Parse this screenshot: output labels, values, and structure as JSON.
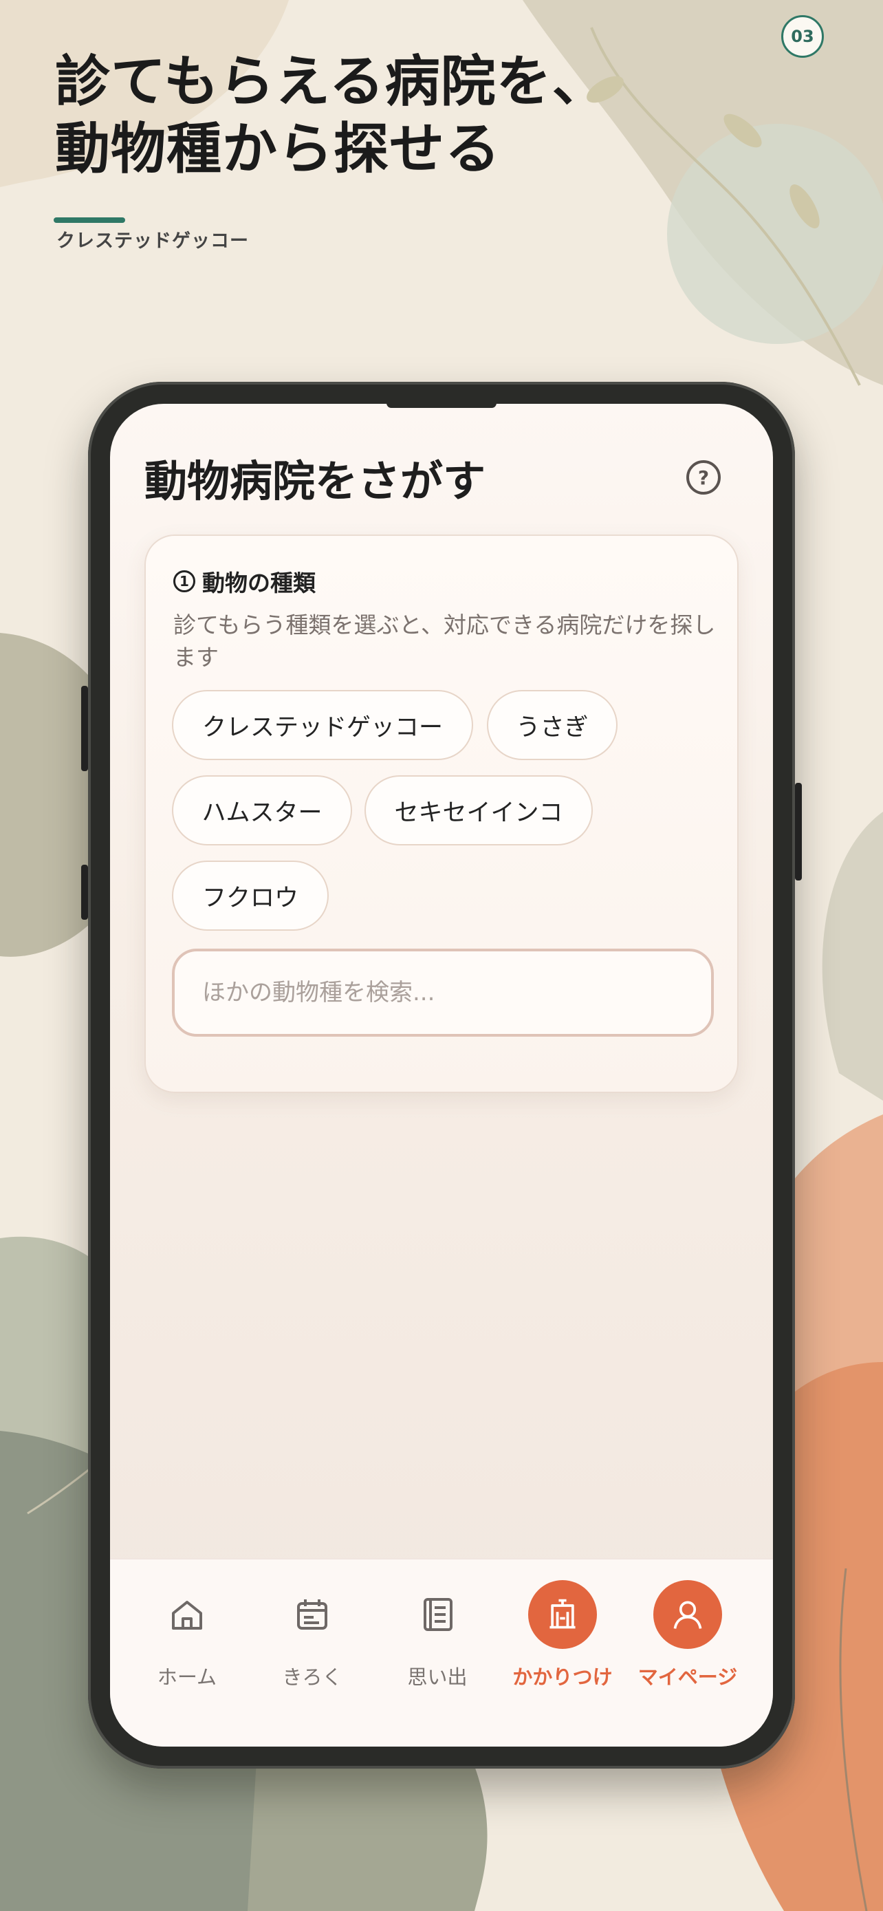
{
  "promo": {
    "badge": "03",
    "headline_line1": "診てもらえる病院を、",
    "headline_line2": "動物種から探せる",
    "subtitle": "クレステッドゲッコー"
  },
  "screen": {
    "title": "動物病院をさがす",
    "help_icon": "question-circle-icon",
    "species_section": {
      "step_number": "1",
      "label": "動物の種類",
      "description": "診てもらう種類を選ぶと、対応できる病院だけを探します",
      "chips": [
        "クレステッドゲッコー",
        "うさぎ",
        "ハムスター",
        "セキセイインコ",
        "フクロウ"
      ],
      "search_placeholder": "ほかの動物種を検索..."
    }
  },
  "bottom_nav": {
    "items": [
      {
        "label": "ホーム",
        "icon": "home-icon"
      },
      {
        "label": "きろく",
        "icon": "calendar-icon"
      },
      {
        "label": "思い出",
        "icon": "notebook-icon"
      },
      {
        "label": "かかりつけ",
        "icon": "hospital-icon"
      },
      {
        "label": "マイページ",
        "icon": "user-icon"
      }
    ]
  },
  "colors": {
    "accent": "#e2663f",
    "brand_green": "#2f7866",
    "text_dark": "#1e1e1e"
  }
}
